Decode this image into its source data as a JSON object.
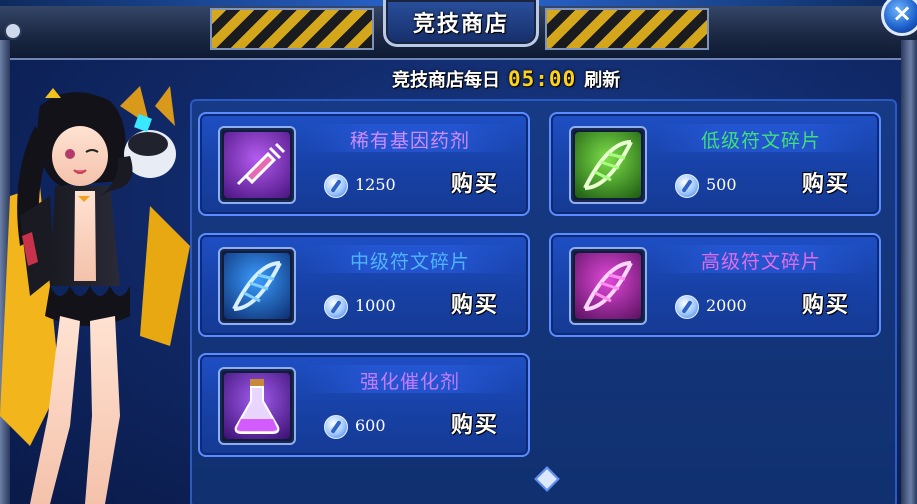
{
  "header": {
    "title": "竞技商店",
    "close_symbol": "×"
  },
  "refresh": {
    "prefix": "竞技商店每日",
    "time": "05:00",
    "suffix": "刷新"
  },
  "items": [
    {
      "name": "稀有基因药剂",
      "name_color": "#d08bff",
      "price": "1250",
      "buy_label": "购买",
      "icon": "syringe-icon",
      "icon_bg": "#7a2bb0"
    },
    {
      "name": "低级符文碎片",
      "name_color": "#3ee07a",
      "price": "500",
      "buy_label": "购买",
      "icon": "dna-green-icon",
      "icon_bg": "#2f8a22"
    },
    {
      "name": "中级符文碎片",
      "name_color": "#4fb4ff",
      "price": "1000",
      "buy_label": "购买",
      "icon": "dna-blue-icon",
      "icon_bg": "#1b5ba8"
    },
    {
      "name": "高级符文碎片",
      "name_color": "#e06ce8",
      "price": "2000",
      "buy_label": "购买",
      "icon": "dna-pink-icon",
      "icon_bg": "#8a1c8c"
    },
    {
      "name": "强化催化剂",
      "name_color": "#c47cff",
      "price": "600",
      "buy_label": "购买",
      "icon": "potion-flask-icon",
      "icon_bg": "#6a2aa8"
    }
  ],
  "currency_icon": "feather-coin-icon"
}
